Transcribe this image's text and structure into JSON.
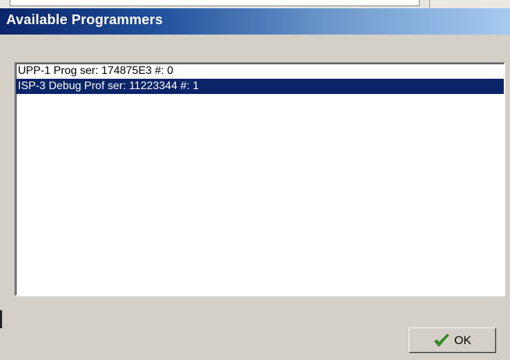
{
  "dialog": {
    "title": "Available Programmers"
  },
  "programmers": [
    {
      "label": "UPP-1 Prog ser: 174875E3 #: 0",
      "selected": false
    },
    {
      "label": "ISP-3 Debug Prof ser: 11223344 #: 1",
      "selected": true
    }
  ],
  "buttons": {
    "ok_label": "OK",
    "ok_icon": "checkmark-icon"
  },
  "colors": {
    "selection": "#0a246a",
    "titlebar_start": "#0a246a",
    "titlebar_end": "#a6caf0",
    "check": "#3a9a2a"
  }
}
